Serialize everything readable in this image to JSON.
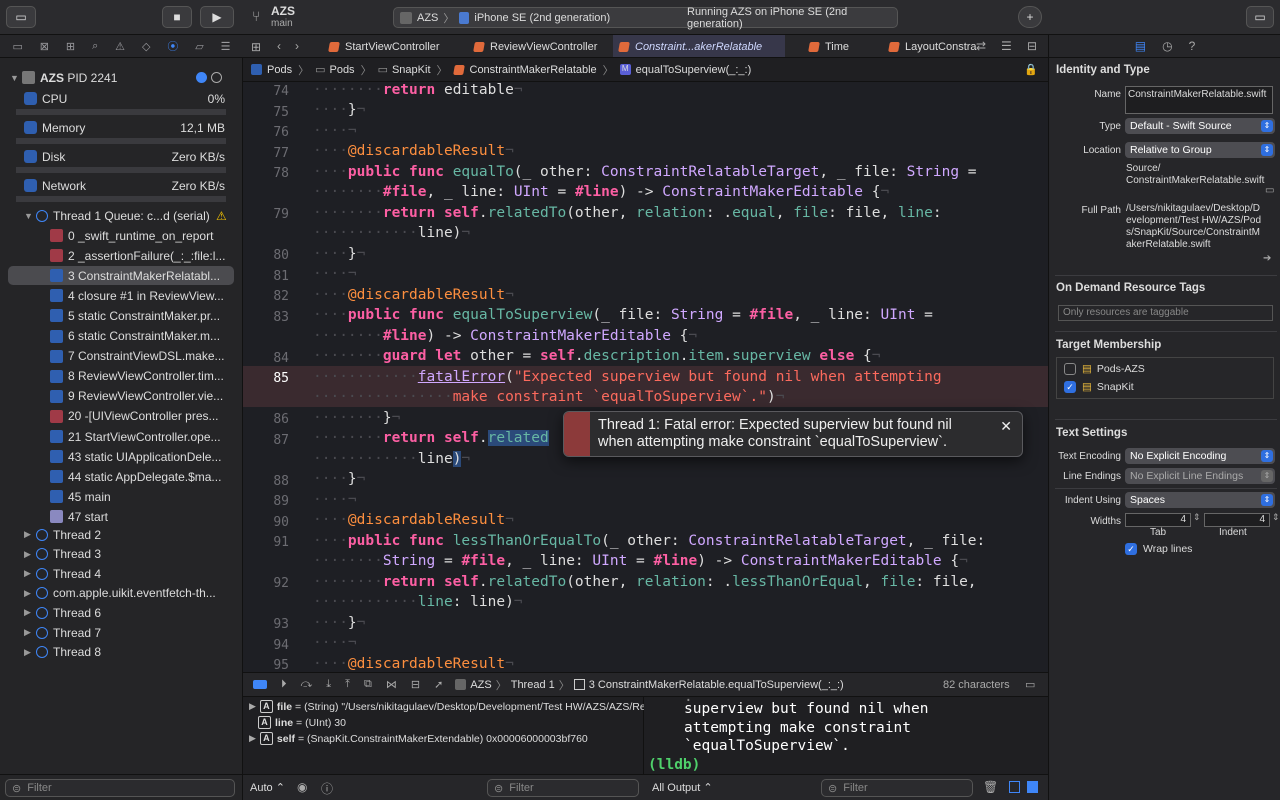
{
  "toolbar": {
    "project": "AZS",
    "branch": "main",
    "scheme_target": "AZS",
    "device": "iPhone SE (2nd generation)",
    "status": "Running AZS on iPhone SE (2nd generation)"
  },
  "navigator": {
    "process": {
      "name": "AZS",
      "pid": "PID 2241"
    },
    "gauges": [
      {
        "label": "CPU",
        "value": "0%"
      },
      {
        "label": "Memory",
        "value": "12,1 MB"
      },
      {
        "label": "Disk",
        "value": "Zero KB/s"
      },
      {
        "label": "Network",
        "value": "Zero KB/s"
      }
    ],
    "thread1": "Thread 1 Queue: c...d (serial)",
    "frames": [
      "0 _swift_runtime_on_report",
      "2 _assertionFailure(_:_:file:l...",
      "3 ConstraintMakerRelatabl...",
      "4 closure #1 in ReviewView...",
      "5 static ConstraintMaker.pr...",
      "6 static ConstraintMaker.m...",
      "7 ConstraintViewDSL.make...",
      "8 ReviewViewController.tim...",
      "9 ReviewViewController.vie...",
      "20 -[UIViewController pres...",
      "21 StartViewController.ope...",
      "43 static UIApplicationDele...",
      "44 static AppDelegate.$ma...",
      "45 main",
      "47 start"
    ],
    "threads": [
      "Thread 2",
      "Thread 3",
      "Thread 4",
      "com.apple.uikit.eventfetch-th...",
      "Thread 6",
      "Thread 7",
      "Thread 8"
    ],
    "filter_placeholder": "Filter"
  },
  "tabs": [
    "StartViewController",
    "ReviewViewController",
    "Constraint...akerRelatable",
    "Time",
    "LayoutConstra"
  ],
  "jumpbar": [
    "Pods",
    "Pods",
    "SnapKit",
    "ConstraintMakerRelatable",
    "equalToSuperview(_:_:)"
  ],
  "editor": {
    "line_numbers": [
      "74",
      "75",
      "76",
      "77",
      "78",
      "",
      "79",
      "",
      "80",
      "81",
      "82",
      "83",
      "",
      "84",
      "85",
      "",
      "86",
      "87",
      "",
      "88",
      "89",
      "90",
      "91",
      "",
      "92",
      "",
      "93",
      "94",
      "95"
    ],
    "error": "Thread 1: Fatal error: Expected superview but found nil when attempting make constraint `equalToSuperview`."
  },
  "debugbar": {
    "target": "AZS",
    "thread": "Thread 1",
    "frame": "3 ConstraintMakerRelatable.equalToSuperview(_:_:)",
    "chars": "82 characters"
  },
  "variables": [
    {
      "badge": "A",
      "name": "file",
      "detail": "= (String) \"/Users/nikitagulaev/Desktop/Development/Test HW/AZS/AZS/Re..."
    },
    {
      "badge": "A",
      "name": "line",
      "detail": "= (UInt) 30"
    },
    {
      "badge": "A",
      "name": "self",
      "detail": "= (SnapKit.ConstraintMakerExtendable) 0x00006000003bf760"
    }
  ],
  "console": {
    "lines": [
      "superview but found nil when",
      "attempting make constraint",
      "`equalToSuperview`."
    ],
    "prompt": "(lldb)"
  },
  "bottom": {
    "auto": "Auto",
    "filter": "Filter",
    "output": "All Output",
    "filter2": "Filter"
  },
  "inspector": {
    "identity_title": "Identity and Type",
    "name_label": "Name",
    "name_value": "ConstraintMakerRelatable.swift",
    "type_label": "Type",
    "type_value": "Default - Swift Source",
    "location_label": "Location",
    "location_value": "Relative to Group",
    "rel_path": "Source/ ConstraintMakerRelatable.swift",
    "fullpath_label": "Full Path",
    "fullpath_value": "/Users/nikitagulaev/Desktop/Development/Test HW/AZS/Pods/SnapKit/Source/ConstraintMakerRelatable.swift",
    "ondemand_title": "On Demand Resource Tags",
    "ondemand_placeholder": "Only resources are taggable",
    "membership_title": "Target Membership",
    "targets": [
      {
        "name": "Pods-AZS",
        "checked": false
      },
      {
        "name": "SnapKit",
        "checked": true
      }
    ],
    "text_title": "Text Settings",
    "encoding_label": "Text Encoding",
    "encoding_value": "No Explicit Encoding",
    "endings_label": "Line Endings",
    "endings_value": "No Explicit Line Endings",
    "indent_label": "Indent Using",
    "indent_value": "Spaces",
    "widths_label": "Widths",
    "tab_value": "4",
    "indent_num": "4",
    "tab_label": "Tab",
    "indent_sub": "Indent",
    "wrap_label": "Wrap lines"
  }
}
